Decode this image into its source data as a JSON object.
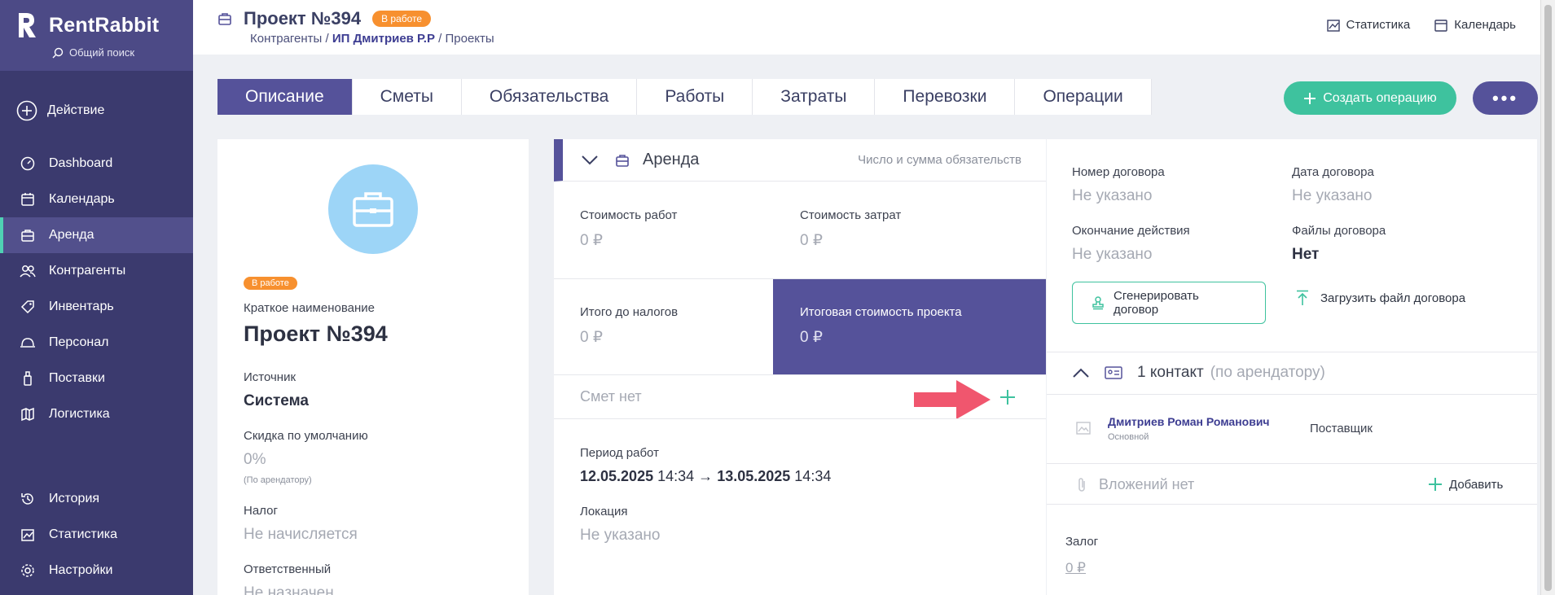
{
  "app": {
    "name": "RentRabbit",
    "global_search": "Общий поиск",
    "action": "Действие"
  },
  "nav": [
    {
      "label": "Dashboard",
      "icon": "dashboard-icon"
    },
    {
      "label": "Календарь",
      "icon": "calendar-icon"
    },
    {
      "label": "Аренда",
      "icon": "briefcase-icon",
      "active": true
    },
    {
      "label": "Контрагенты",
      "icon": "users-icon"
    },
    {
      "label": "Инвентарь",
      "icon": "tag-icon"
    },
    {
      "label": "Персонал",
      "icon": "hardhat-icon"
    },
    {
      "label": "Поставки",
      "icon": "bottle-icon"
    },
    {
      "label": "Логистика",
      "icon": "map-icon"
    }
  ],
  "nav_bottom": [
    {
      "label": "История",
      "icon": "history-icon"
    },
    {
      "label": "Статистика",
      "icon": "chart-icon"
    },
    {
      "label": "Настройки",
      "icon": "gear-icon"
    }
  ],
  "header": {
    "title": "Проект №394",
    "status": "В работе",
    "breadcrumbs": [
      "Контрагенты",
      "ИП Дмитриев Р.Р",
      "Проекты"
    ],
    "stats_label": "Статистика",
    "calendar_label": "Календарь"
  },
  "tabs": [
    "Описание",
    "Сметы",
    "Обязательства",
    "Работы",
    "Затраты",
    "Перевозки",
    "Операции"
  ],
  "buttons": {
    "create_operation": "Создать операцию",
    "more": "•••"
  },
  "left_card": {
    "status": "В работе",
    "short_name_label": "Краткое наименование",
    "short_name": "Проект №394",
    "source_label": "Источник",
    "source": "Система",
    "discount_label": "Скидка по умолчанию",
    "discount": "0%",
    "discount_note": "(По арендатору)",
    "tax_label": "Налог",
    "tax": "Не начисляется",
    "responsible_label": "Ответственный",
    "responsible": "Не назначен"
  },
  "mid_card": {
    "header_title": "Аренда",
    "header_right": "Число и сумма обязательств",
    "work_cost_label": "Стоимость работ",
    "work_cost": "0 ₽",
    "expense_cost_label": "Стоимость затрат",
    "expense_cost": "0 ₽",
    "pre_tax_label": "Итого до налогов",
    "pre_tax": "0 ₽",
    "total_label": "Итоговая стоимость проекта",
    "total": "0 ₽",
    "no_estimates": "Смет нет",
    "period_label": "Период работ",
    "period_start_date": "12.05.2025",
    "period_start_time": "14:34",
    "period_arrow": "→",
    "period_end_date": "13.05.2025",
    "period_end_time": "14:34",
    "location_label": "Локация",
    "location": "Не указано"
  },
  "right_card": {
    "contract_number_label": "Номер договора",
    "contract_number": "Не указано",
    "contract_date_label": "Дата договора",
    "contract_date": "Не указано",
    "end_label": "Окончание действия",
    "end_value": "Не указано",
    "files_label": "Файлы договора",
    "files_value": "Нет",
    "generate_btn": "Сгенерировать договор",
    "upload_btn": "Загрузить файл договора",
    "contacts_title": "1 контакт",
    "contacts_note": "(по арендатору)",
    "contact_name": "Дмитриев Роман Романович",
    "contact_sub": "Основной",
    "contact_role": "Поставщик",
    "attachments_label": "Вложений нет",
    "add_label": "Добавить",
    "deposit_label": "Залог",
    "deposit_value": "0 ₽"
  }
}
